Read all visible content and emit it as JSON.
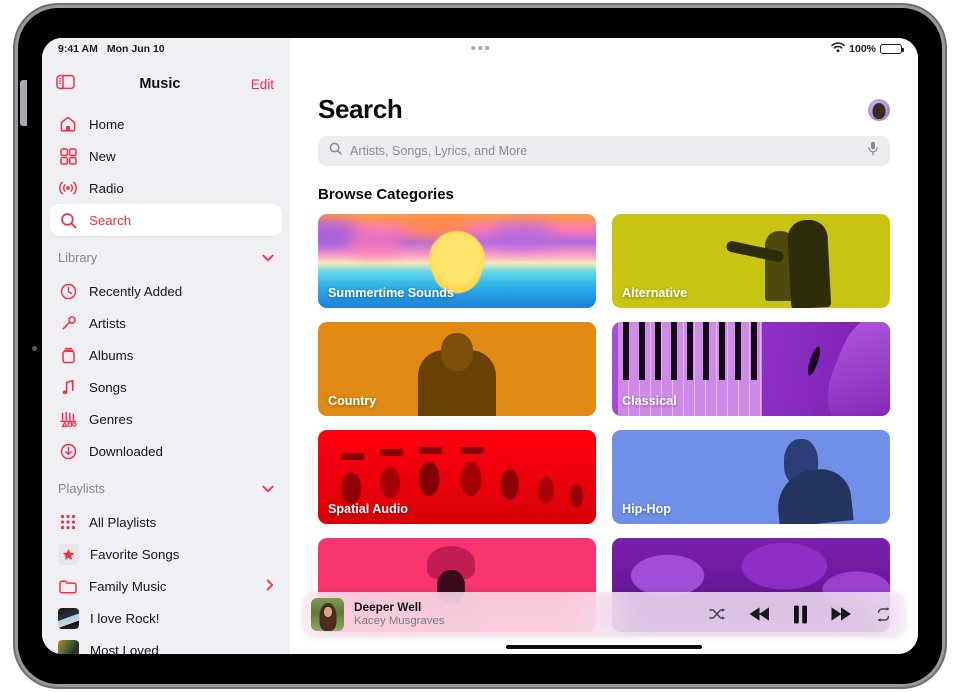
{
  "status_bar": {
    "time": "9:41 AM",
    "date": "Mon Jun 10",
    "wifi_icon": "wifi-icon",
    "battery_percent": "100%",
    "battery_icon": "battery-full-icon",
    "multitask_handle": "multitask-handle-icon"
  },
  "sidebar": {
    "toggle_icon": "sidebar-toggle-icon",
    "title": "Music",
    "edit_label": "Edit",
    "primary_items": [
      {
        "label": "Home",
        "icon": "home-icon",
        "active": false
      },
      {
        "label": "New",
        "icon": "grid-icon",
        "active": false
      },
      {
        "label": "Radio",
        "icon": "radio-waves-icon",
        "active": false
      },
      {
        "label": "Search",
        "icon": "search-icon",
        "active": true
      }
    ],
    "library": {
      "header": "Library",
      "chevron": "chevron-down-icon",
      "items": [
        {
          "label": "Recently Added",
          "icon": "clock-icon"
        },
        {
          "label": "Artists",
          "icon": "microphone-icon"
        },
        {
          "label": "Albums",
          "icon": "album-icon"
        },
        {
          "label": "Songs",
          "icon": "music-note-icon"
        },
        {
          "label": "Genres",
          "icon": "genres-icon"
        },
        {
          "label": "Downloaded",
          "icon": "download-circle-icon"
        }
      ]
    },
    "playlists": {
      "header": "Playlists",
      "chevron": "chevron-down-icon",
      "items": [
        {
          "label": "All Playlists",
          "icon": "playlists-grid-icon",
          "type": "icon"
        },
        {
          "label": "Favorite Songs",
          "icon": "star-icon",
          "type": "icon"
        },
        {
          "label": "Family Music",
          "icon": "folder-icon",
          "type": "icon",
          "disclosure": "chevron-right-icon"
        },
        {
          "label": "I love Rock!",
          "icon": "playlist-artwork",
          "type": "artwork"
        },
        {
          "label": "Most Loved",
          "icon": "playlist-artwork",
          "type": "artwork"
        }
      ]
    }
  },
  "main": {
    "page_title": "Search",
    "avatar": "user-avatar",
    "search": {
      "icon": "search-icon",
      "placeholder": "Artists, Songs, Lyrics, and More",
      "value": "",
      "mic_icon": "microphone-icon"
    },
    "browse_title": "Browse Categories",
    "categories": [
      {
        "label": "Summertime Sounds",
        "art": "art-summer",
        "accent": "#ff9d3c"
      },
      {
        "label": "Alternative",
        "art": "art-alt",
        "accent": "#c8c413"
      },
      {
        "label": "Country",
        "art": "art-country",
        "accent": "#e08a14"
      },
      {
        "label": "Classical",
        "art": "art-classical",
        "accent": "#8d2fc4"
      },
      {
        "label": "Spatial Audio",
        "art": "art-spatial",
        "accent": "#ff0010"
      },
      {
        "label": "Hip-Hop",
        "art": "art-hiphop",
        "accent": "#6f8fe8"
      },
      {
        "label": "",
        "art": "art-pink",
        "accent": "#f8356f"
      },
      {
        "label": "",
        "art": "art-deeppurple",
        "accent": "#7a1fae"
      }
    ]
  },
  "now_playing": {
    "artwork": "album-artwork",
    "title": "Deeper Well",
    "artist": "Kacey Musgraves",
    "controls": [
      {
        "name": "shuffle-button",
        "icon": "shuffle-icon"
      },
      {
        "name": "previous-button",
        "icon": "rewind-icon"
      },
      {
        "name": "pause-button",
        "icon": "pause-icon"
      },
      {
        "name": "next-button",
        "icon": "fast-forward-icon"
      },
      {
        "name": "repeat-button",
        "icon": "repeat-icon"
      }
    ]
  },
  "colors": {
    "accent_red": "#fa2b42",
    "sidebar_bg": "#f0eff4",
    "text_primary": "#15151a",
    "text_secondary": "#89888f"
  }
}
